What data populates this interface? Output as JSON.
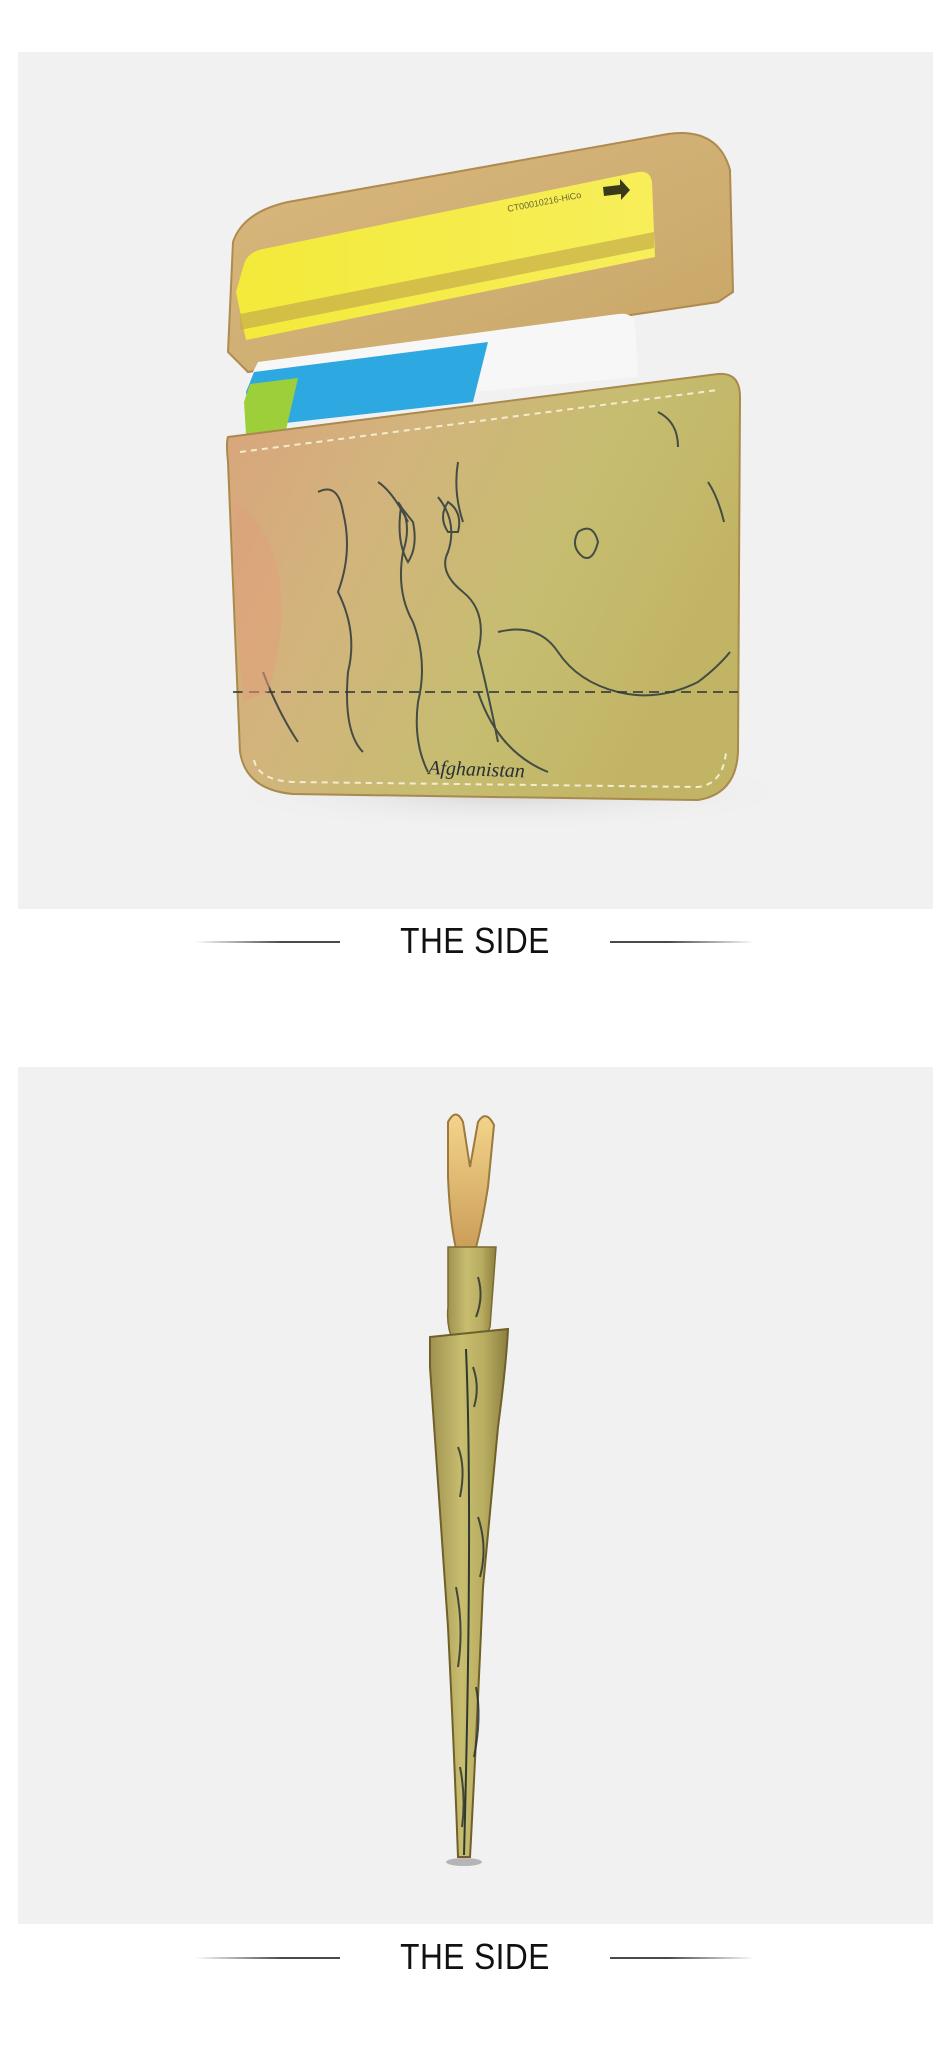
{
  "sections": [
    {
      "caption": "THE SIDE"
    },
    {
      "caption": "THE SIDE"
    }
  ],
  "photo_text": {
    "card_code": "CT00010216-HiCo",
    "map_label": "Afghanistan"
  },
  "colors": {
    "page_background": "#ffffff",
    "panel_background": "#f1f1f1",
    "caption_text": "#111111",
    "caption_rule": "#4a4a4a",
    "leather_gold": "#c9b46a",
    "leather_tan": "#d7a878",
    "card_yellow": "#f2e83a",
    "card_blue": "#2ea8e0",
    "card_green": "#9ccf3a"
  }
}
